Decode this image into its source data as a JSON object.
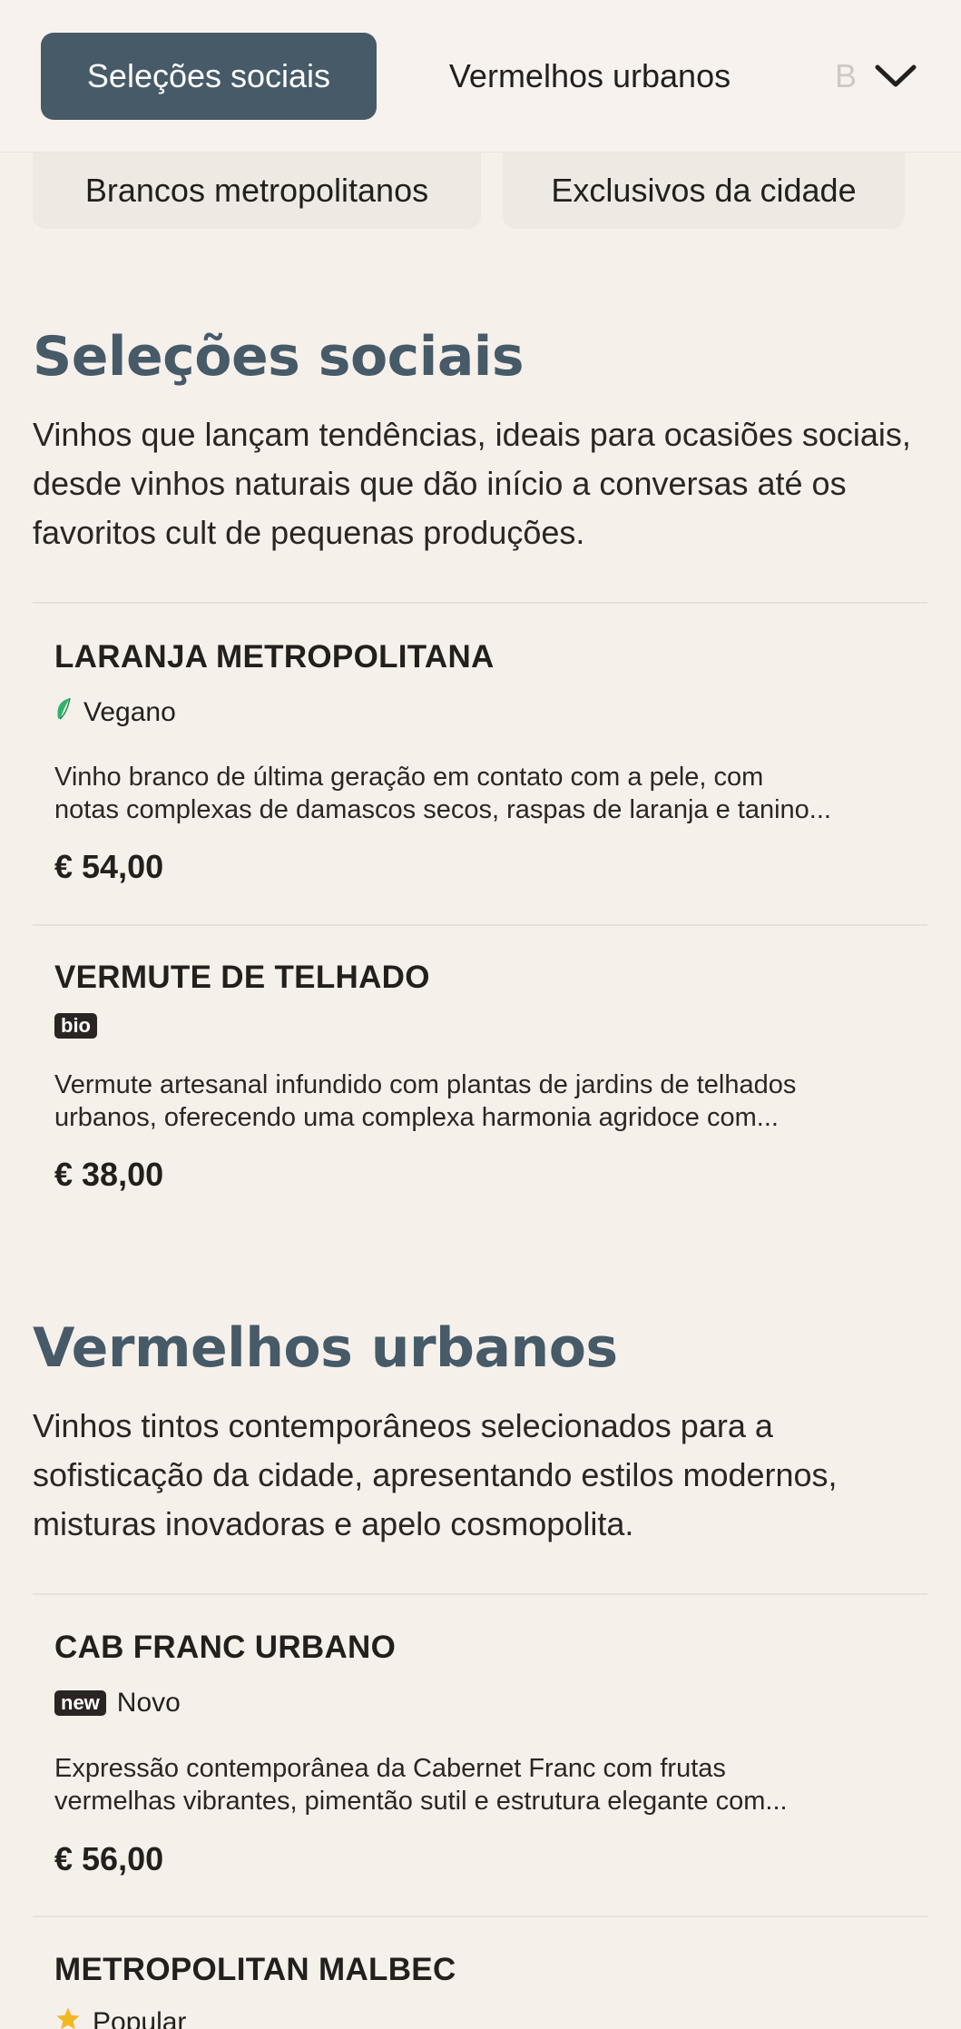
{
  "tabs": {
    "active": "Seleções sociais",
    "second": "Vermelhos urbanos",
    "third_partial": "B"
  },
  "chips": [
    "Brancos metropolitanos",
    "Exclusivos da cidade"
  ],
  "sections": [
    {
      "title": "Seleções sociais",
      "description": "Vinhos que lançam tendências, ideais para ocasiões sociais, desde vinhos naturais que dão início a conversas até os favoritos cult de pequenas produções.",
      "items": [
        {
          "name": "LARANJA METROPOLITANA",
          "tag_label": "Vegano",
          "desc_line1": "Vinho branco de última geração em contato com a pele, com",
          "desc_line2": "notas complexas de damascos secos, raspas de laranja e tanino...",
          "price": "€ 54,00"
        },
        {
          "name": "VERMUTE DE TELHADO",
          "badge": "bio",
          "desc_line1": "Vermute artesanal infundido com plantas de jardins de telhados",
          "desc_line2": "urbanos, oferecendo uma complexa harmonia agridoce com...",
          "price": "€ 38,00"
        }
      ]
    },
    {
      "title": "Vermelhos urbanos",
      "description": "Vinhos tintos contemporâneos selecionados para a sofisticação da cidade, apresentando estilos modernos, misturas inovadoras e apelo cosmopolita.",
      "items": [
        {
          "name": "CAB FRANC URBANO",
          "badge": "new",
          "tag_label": "Novo",
          "desc_line1": "Expressão contemporânea da Cabernet Franc com frutas",
          "desc_line2": "vermelhas vibrantes, pimentão sutil e estrutura elegante com...",
          "price": "€ 56,00"
        },
        {
          "name": "METROPOLITAN MALBEC",
          "tag_label": "Popular"
        }
      ]
    }
  ],
  "colors": {
    "accent": "#465a68",
    "background": "#f6f0eb",
    "vegan_leaf": "#2fb36b",
    "star": "#f2b824"
  },
  "icons": {
    "expand": "chevron-down-icon",
    "vegan": "leaf-icon",
    "popular": "star-icon"
  }
}
